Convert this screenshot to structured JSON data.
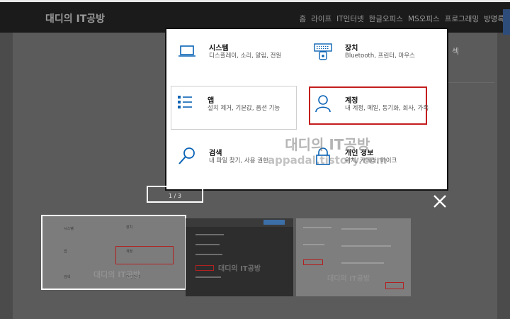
{
  "site": {
    "title": "대디의 IT공방",
    "nav": [
      "홈",
      "라이프",
      "IT인터넷",
      "한글오피스",
      "MS오피스",
      "프로그래밍",
      "방명록"
    ]
  },
  "background_fragment": "섹",
  "settings": {
    "tiles": {
      "system": {
        "name": "시스템",
        "desc": "디스플레이, 소리, 알림, 전원",
        "icon": "laptop-icon"
      },
      "devices": {
        "name": "장치",
        "desc": "Bluetooth, 프린터, 마우스",
        "icon": "keyboard-icon"
      },
      "apps": {
        "name": "앱",
        "desc": "설치 제거, 기본값, 옵션 기능",
        "icon": "list-icon"
      },
      "accounts": {
        "name": "계정",
        "desc": "내 계정, 메일, 동기화, 회사, 가족",
        "icon": "person-icon"
      },
      "search": {
        "name": "검색",
        "desc": "내 파일 찾기, 사용 권한",
        "icon": "search-icon"
      },
      "privacy": {
        "name": "개인 정보",
        "desc": "위치, 카메라, 마이크",
        "icon": "lock-icon"
      }
    },
    "accent": "#0a63b5",
    "highlight": "#c41e1e"
  },
  "watermark": {
    "line1": "대디의 IT공방",
    "line2": "appadal.tistory.com"
  },
  "viewer": {
    "counter": "1 / 3",
    "close_icon": "close-icon",
    "thumbnails": [
      {
        "labels": [
          "시스템",
          "장치",
          "앱",
          "계정",
          "검색",
          "개인 정보"
        ],
        "watermark": "대디의 IT공방"
      },
      {
        "watermark": "대디의 IT공방"
      },
      {
        "watermark": "대디의 IT공방"
      }
    ]
  }
}
